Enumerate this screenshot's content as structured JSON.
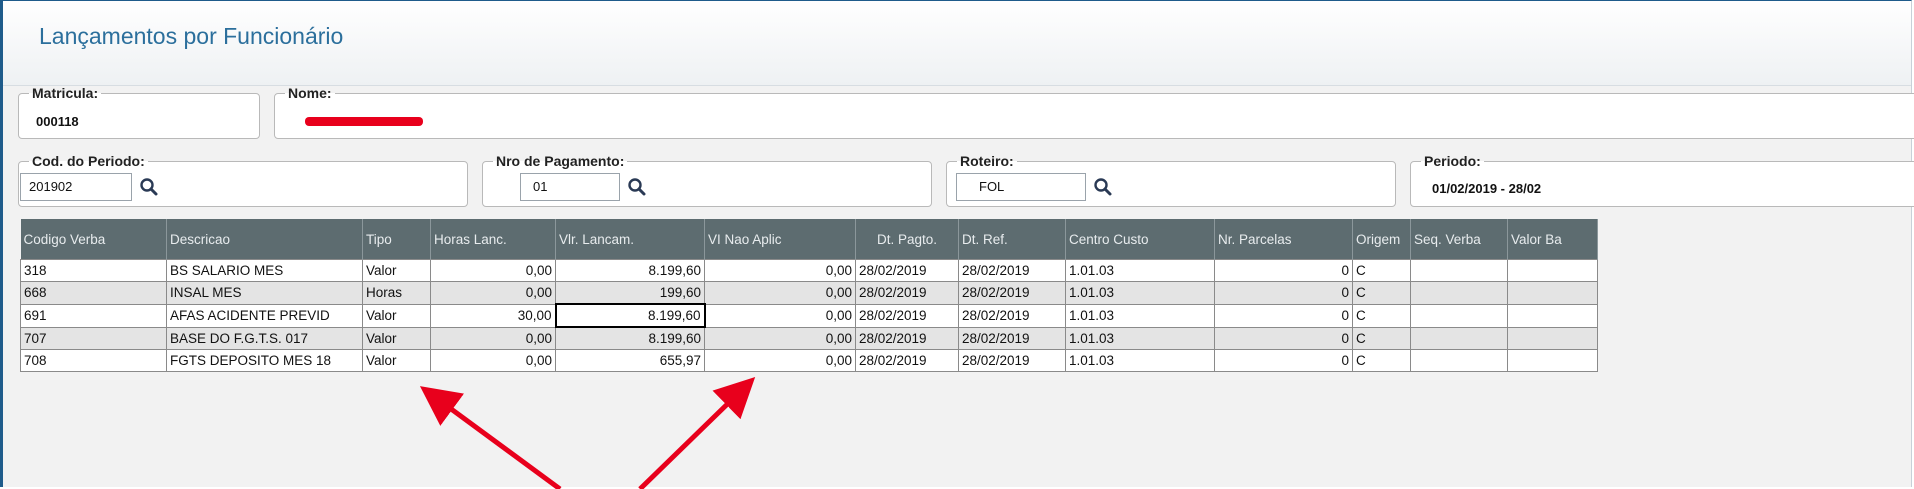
{
  "window": {
    "title": "Lançamentos por Funcionário"
  },
  "header": {
    "matricula": {
      "label": "Matricula:",
      "value": "000118"
    },
    "nome": {
      "label": "Nome:"
    },
    "cod_periodo": {
      "label": "Cod. do Periodo:",
      "value": "201902"
    },
    "nro_pagamento": {
      "label": "Nro de Pagamento:",
      "value": "01"
    },
    "roteiro": {
      "label": "Roteiro:",
      "value": "FOL"
    },
    "periodo": {
      "label": "Periodo:",
      "value": "01/02/2019 - 28/02"
    }
  },
  "icons": {
    "lookup": "search-icon"
  },
  "colors": {
    "title": "#2b6f9c",
    "grid_header": "#5d6c70",
    "annotation": "#e8001c"
  },
  "grid": {
    "columns": [
      "Codigo Verba",
      "Descricao",
      "Tipo",
      "Horas Lanc.",
      "Vlr. Lancam.",
      "VI Nao Aplic",
      "Dt. Pagto.",
      "Dt. Ref.",
      "Centro Custo",
      "Nr. Parcelas",
      "Origem",
      "Seq. Verba",
      "Valor Ba"
    ],
    "rows": [
      [
        "318",
        "BS SALARIO MES",
        "Valor",
        "0,00",
        "8.199,60",
        "0,00",
        "28/02/2019",
        "28/02/2019",
        "1.01.03",
        "0",
        "C",
        "",
        ""
      ],
      [
        "668",
        "INSAL MES",
        "Horas",
        "0,00",
        "199,60",
        "0,00",
        "28/02/2019",
        "28/02/2019",
        "1.01.03",
        "0",
        "C",
        "",
        ""
      ],
      [
        "691",
        "AFAS ACIDENTE PREVID",
        "Valor",
        "30,00",
        "8.199,60",
        "0,00",
        "28/02/2019",
        "28/02/2019",
        "1.01.03",
        "0",
        "C",
        "",
        ""
      ],
      [
        "707",
        "BASE DO F.G.T.S. 017",
        "Valor",
        "0,00",
        "8.199,60",
        "0,00",
        "28/02/2019",
        "28/02/2019",
        "1.01.03",
        "0",
        "C",
        "",
        ""
      ],
      [
        "708",
        "FGTS DEPOSITO MES 18",
        "Valor",
        "0,00",
        "655,97",
        "0,00",
        "28/02/2019",
        "28/02/2019",
        "1.01.03",
        "0",
        "C",
        "",
        ""
      ]
    ]
  }
}
